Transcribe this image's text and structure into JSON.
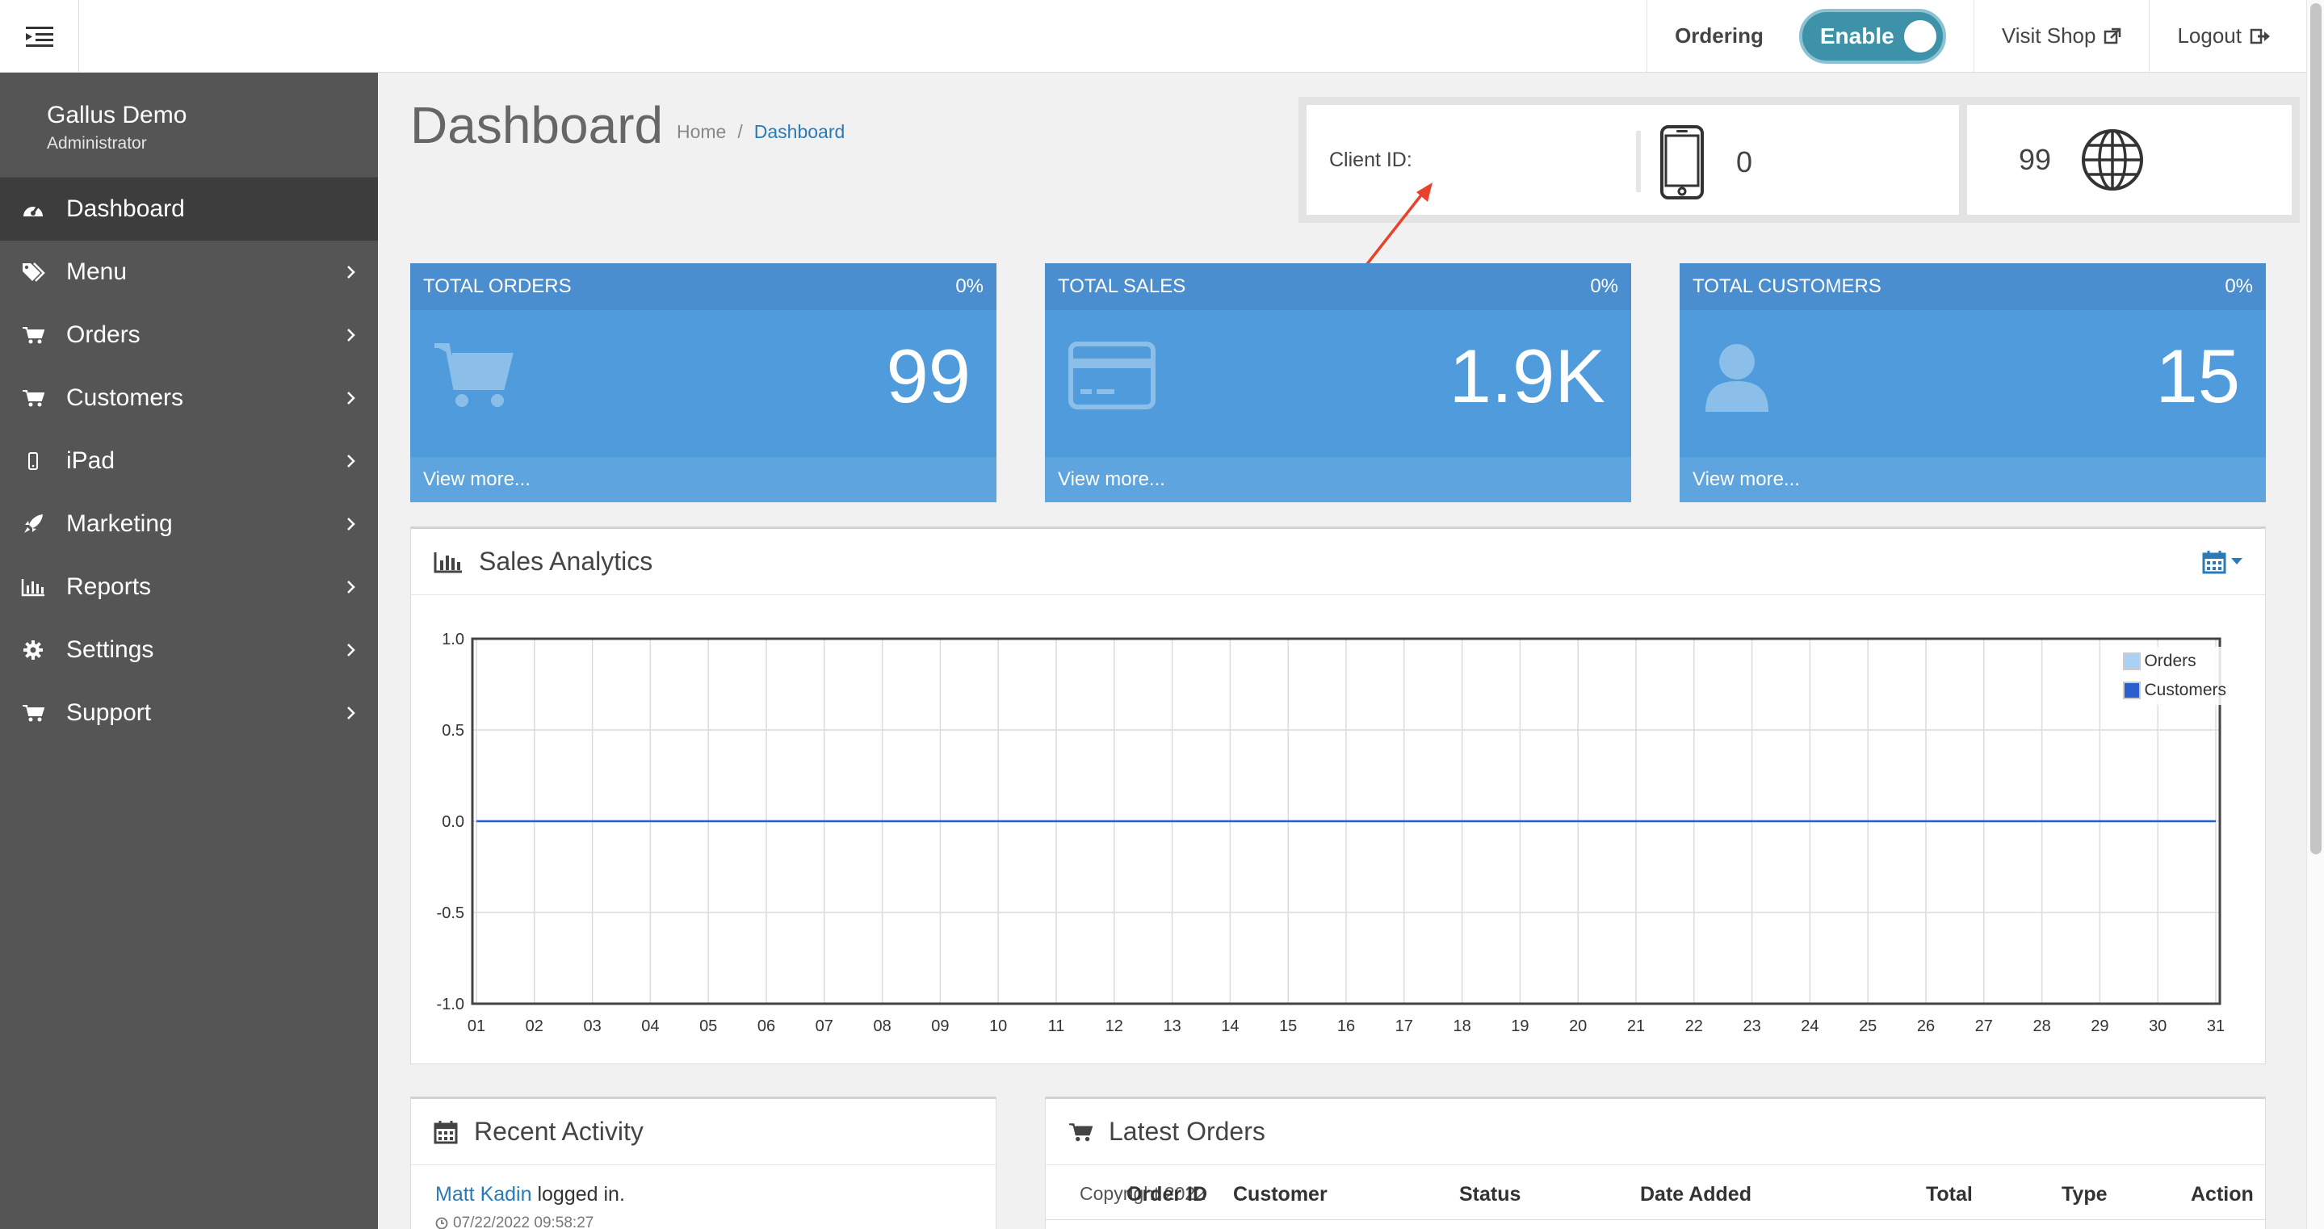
{
  "topbar": {
    "ordering_label": "Ordering",
    "toggle_label": "Enable",
    "visit_shop": "Visit Shop",
    "logout": "Logout"
  },
  "sidebar": {
    "user_name": "Gallus Demo",
    "user_role": "Administrator",
    "items": [
      {
        "label": "Dashboard",
        "icon": "dashboard-icon",
        "active": true
      },
      {
        "label": "Menu",
        "icon": "tags-icon"
      },
      {
        "label": "Orders",
        "icon": "cart-icon"
      },
      {
        "label": "Customers",
        "icon": "cart-icon"
      },
      {
        "label": "iPad",
        "icon": "mobile-icon"
      },
      {
        "label": "Marketing",
        "icon": "rocket-icon"
      },
      {
        "label": "Reports",
        "icon": "bar-chart-icon"
      },
      {
        "label": "Settings",
        "icon": "gear-icon"
      },
      {
        "label": "Support",
        "icon": "cart-icon"
      }
    ]
  },
  "header": {
    "title": "Dashboard",
    "breadcrumb": [
      "Home",
      "Dashboard"
    ],
    "breadcrumb_sep": "/"
  },
  "client": {
    "label": "Client ID:",
    "device_count": "0",
    "web_count": "99"
  },
  "stats": [
    {
      "title": "TOTAL ORDERS",
      "percent": "0%",
      "value": "99",
      "link": "View more...",
      "icon": "cart-icon"
    },
    {
      "title": "TOTAL SALES",
      "percent": "0%",
      "value": "1.9K",
      "link": "View more...",
      "icon": "credit-card-icon"
    },
    {
      "title": "TOTAL CUSTOMERS",
      "percent": "0%",
      "value": "15",
      "link": "View more...",
      "icon": "user-icon"
    }
  ],
  "analytics": {
    "title": "Sales Analytics"
  },
  "chart_data": {
    "type": "line",
    "x": [
      "01",
      "02",
      "03",
      "04",
      "05",
      "06",
      "07",
      "08",
      "09",
      "10",
      "11",
      "12",
      "13",
      "14",
      "15",
      "16",
      "17",
      "18",
      "19",
      "20",
      "21",
      "22",
      "23",
      "24",
      "25",
      "26",
      "27",
      "28",
      "29",
      "30",
      "31"
    ],
    "ylim": [
      -1.0,
      1.0
    ],
    "yticks": [
      "1.0",
      "0.5",
      "0.0",
      "-0.5",
      "-1.0"
    ],
    "grid": true,
    "legend_position": "top-right",
    "series": [
      {
        "name": "Orders",
        "color": "#a9d1f5",
        "values": [
          0,
          0,
          0,
          0,
          0,
          0,
          0,
          0,
          0,
          0,
          0,
          0,
          0,
          0,
          0,
          0,
          0,
          0,
          0,
          0,
          0,
          0,
          0,
          0,
          0,
          0,
          0,
          0,
          0,
          0,
          0
        ]
      },
      {
        "name": "Customers",
        "color": "#2b5fd0",
        "values": [
          0,
          0,
          0,
          0,
          0,
          0,
          0,
          0,
          0,
          0,
          0,
          0,
          0,
          0,
          0,
          0,
          0,
          0,
          0,
          0,
          0,
          0,
          0,
          0,
          0,
          0,
          0,
          0,
          0,
          0,
          0
        ]
      }
    ]
  },
  "activity": {
    "title": "Recent Activity",
    "entries": [
      {
        "user": "Matt Kadin",
        "action": "logged in.",
        "time": "07/22/2022 09:58:27"
      }
    ]
  },
  "orders": {
    "title": "Latest Orders",
    "copyright": "Copyright 2022",
    "columns": [
      "Order ID",
      "Customer",
      "Status",
      "Date Added",
      "Total",
      "Type",
      "Action"
    ]
  },
  "colors": {
    "sidebar": "#555555",
    "stat_card": "#4f9bdb",
    "toggle": "#3d92aa",
    "link": "#2a7ab8",
    "arrow": "#e8412c"
  }
}
